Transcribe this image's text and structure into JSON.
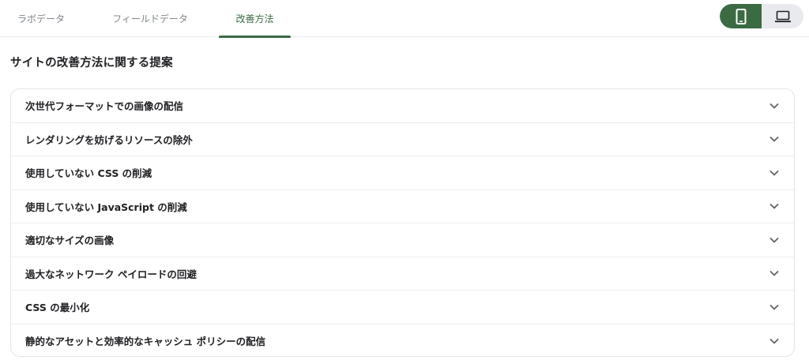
{
  "tabs": [
    {
      "label": "ラボデータ"
    },
    {
      "label": "フィールドデータ"
    },
    {
      "label": "改善方法"
    }
  ],
  "active_tab": "改善方法",
  "device_toggle": {
    "options": [
      "mobile-icon",
      "laptop-icon"
    ],
    "selected": "mobile-icon"
  },
  "section_title": "サイトの改善方法に関する提案",
  "items": [
    {
      "label": "次世代フォーマットでの画像の配信"
    },
    {
      "label": "レンダリングを妨げるリソースの除外"
    },
    {
      "label": "使用していない CSS の削減"
    },
    {
      "label": "使用していない JavaScript の削減"
    },
    {
      "label": "適切なサイズの画像"
    },
    {
      "label": "過大なネットワーク ペイロードの回避"
    },
    {
      "label": "CSS の最小化"
    },
    {
      "label": "静的なアセットと効率的なキャッシュ ポリシーの配信"
    }
  ],
  "colors": {
    "accent": "#3b6b43",
    "toggle_bg": "#e8eaed"
  }
}
